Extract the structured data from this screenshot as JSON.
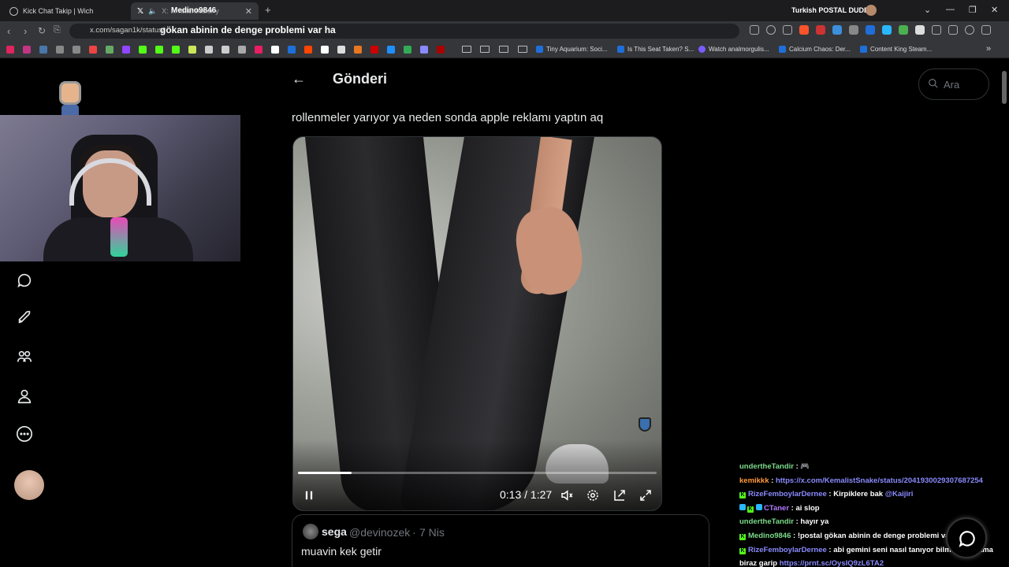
{
  "browser": {
    "tabs": [
      {
        "title": "Kick Chat Takip | Wich"
      },
      {
        "title": "X: ... rollenmeler y"
      }
    ],
    "overlay_title": "Medino9846",
    "profile_name": "Turkish POSTAL DUDE",
    "url": "x.com/sagan1k/status/",
    "chat_overlay_url_text": "gökan abinin de denge problemi var ha",
    "bookmarks": [
      {
        "label": "Tiny Aquarium: Soci..."
      },
      {
        "label": "Is This Seat Taken? S..."
      },
      {
        "label": "Watch analmorgulis..."
      },
      {
        "label": "Calcium Chaos: Der..."
      },
      {
        "label": "Content King Steam..."
      }
    ]
  },
  "page": {
    "heading": "Gönderi",
    "search_placeholder": "Ara",
    "tweet_text": "rollenmeler yarıyor ya neden sonda apple reklamı yaptın aq",
    "video": {
      "time": "0:13 / 1:27",
      "progress": 0.149
    },
    "quote": {
      "name": "sega",
      "handle": "@devinozek",
      "dot": "·",
      "date": "7 Nis",
      "text": "muavin kek getir"
    }
  },
  "chat": {
    "messages": [
      {
        "user": "undertheTandir",
        "color": "#7cdb8a",
        "text": " : 🎮",
        "badges": []
      },
      {
        "user": "kemikkk",
        "color": "#ff9a3c",
        "text": " : ",
        "link": "https://x.com/KemalistSnake/status/2041930029307687254",
        "badges": []
      },
      {
        "user": "RizeFemboylarDernee",
        "color": "#8a8aff",
        "text": " : Kirpiklere bak ",
        "mention": "@Kaijiri",
        "badges": [
          "K"
        ]
      },
      {
        "user": "CTaner",
        "color": "#b37aff",
        "text": " : ai slop",
        "badges": [
          "G",
          "K",
          "G"
        ]
      },
      {
        "user": "undertheTandir",
        "color": "#7cdb8a",
        "text": " : hayır ya",
        "badges": []
      },
      {
        "user": "Medino9846",
        "color": "#7cdb8a",
        "text": " : !postal gökan abinin de denge problemi var ha",
        "badges": [
          "K"
        ]
      },
      {
        "user": "RizeFemboylarDernee",
        "color": "#8a8aff",
        "text": " : abi gemini seni nasıl tanıyor bilmiyorum ama biraz garip ",
        "link": "https://prnt.sc/OysIQ9zL6TA2",
        "badges": [
          "K"
        ]
      }
    ]
  }
}
